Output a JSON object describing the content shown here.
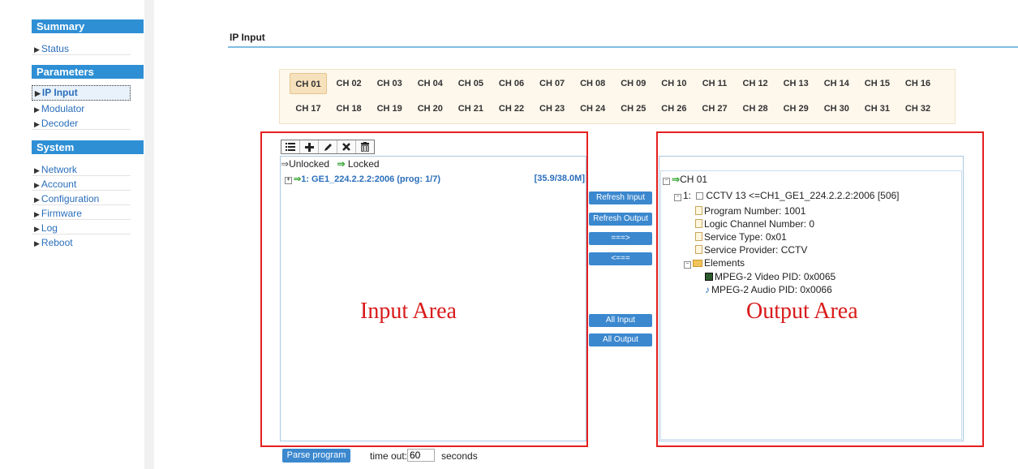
{
  "sidebar": {
    "sections": [
      {
        "title": "Summary",
        "items": [
          "Status"
        ]
      },
      {
        "title": "Parameters",
        "items": [
          "IP Input",
          "Modulator",
          "Decoder"
        ]
      },
      {
        "title": "System",
        "items": [
          "Network",
          "Account",
          "Configuration",
          "Firmware",
          "Log",
          "Reboot"
        ]
      }
    ],
    "active_item": "IP Input"
  },
  "page": {
    "title": "IP Input"
  },
  "channels": {
    "row1": [
      "CH 01",
      "CH 02",
      "CH 03",
      "CH 04",
      "CH 05",
      "CH 06",
      "CH 07",
      "CH 08",
      "CH 09",
      "CH 10",
      "CH 11",
      "CH 12",
      "CH 13",
      "CH 14",
      "CH 15",
      "CH 16"
    ],
    "row2": [
      "CH 17",
      "CH 18",
      "CH 19",
      "CH 20",
      "CH 21",
      "CH 22",
      "CH 23",
      "CH 24",
      "CH 25",
      "CH 26",
      "CH 27",
      "CH 28",
      "CH 29",
      "CH 30",
      "CH 31",
      "CH 32"
    ],
    "selected": "CH 01"
  },
  "toolbar": {
    "icons": [
      "list-icon",
      "add-icon",
      "edit-icon",
      "delete-icon",
      "trash-icon"
    ]
  },
  "input_area": {
    "legend_unlocked": "Unlocked",
    "legend_locked": "Locked",
    "entry_label": "1: GE1_224.2.2.2:2006 (prog: 1/7)",
    "entry_rate": "[35.9/38.0M]",
    "annotation": "Input Area"
  },
  "mid_buttons": {
    "refresh_input": "Refresh Input",
    "refresh_output": "Refresh Output",
    "move_right": "===>",
    "move_left": "<===",
    "all_input": "All Input",
    "all_output": "All Output"
  },
  "output_area": {
    "channel": "CH 01",
    "program": "1: ",
    "program_name": "CCTV 13 <=CH1_GE1_224.2.2.2:2006 [506]",
    "program_number": "Program Number: 1001",
    "logic_channel": "Logic Channel Number: 0",
    "service_type": "Service Type: 0x01",
    "service_provider": "Service Provider: CCTV",
    "elements": "Elements",
    "video_pid": "MPEG-2 Video PID: 0x0065",
    "audio_pid": "MPEG-2 Audio PID: 0x0066",
    "annotation": "Output Area"
  },
  "bottom": {
    "parse_button": "Parse program",
    "timeout_label": "time out:",
    "timeout_value": "60",
    "seconds_label": "seconds"
  },
  "colors": {
    "accent": "#2e8fd5",
    "button": "#3b88cf",
    "highlight_box": "#e51f1f",
    "locked_arrow": "#3aa635"
  }
}
